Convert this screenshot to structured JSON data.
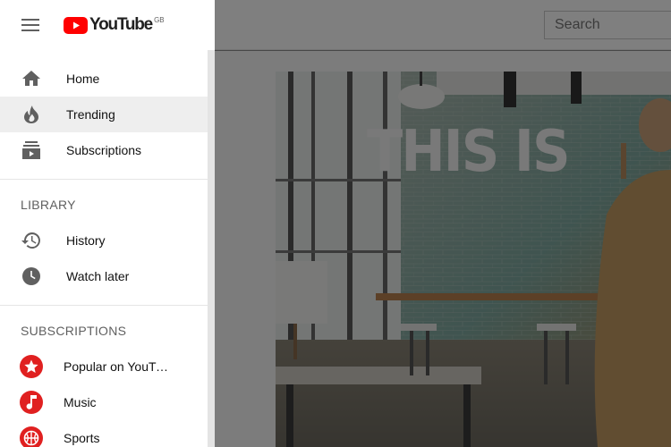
{
  "header": {
    "logo_text": "YouTube",
    "region": "GB",
    "search_placeholder": "Search"
  },
  "video": {
    "overlay_text": "THIS IS"
  },
  "sidebar": {
    "main_items": [
      {
        "label": "Home",
        "icon": "home-icon"
      },
      {
        "label": "Trending",
        "icon": "trending-flame-icon",
        "active": true
      },
      {
        "label": "Subscriptions",
        "icon": "subscriptions-icon"
      }
    ],
    "library": {
      "title": "LIBRARY",
      "items": [
        {
          "label": "History",
          "icon": "history-icon"
        },
        {
          "label": "Watch later",
          "icon": "clock-icon"
        }
      ]
    },
    "subscriptions": {
      "title": "SUBSCRIPTIONS",
      "items": [
        {
          "label": "Popular on YouTube",
          "icon": "star-icon"
        },
        {
          "label": "Music",
          "icon": "music-note-icon"
        },
        {
          "label": "Sports",
          "icon": "basketball-icon"
        }
      ]
    }
  },
  "colors": {
    "brand_red": "#ff0000",
    "channel_avatar_red": "#e02020",
    "active_item_bg": "#eeeeee",
    "icon_gray": "#606060"
  }
}
